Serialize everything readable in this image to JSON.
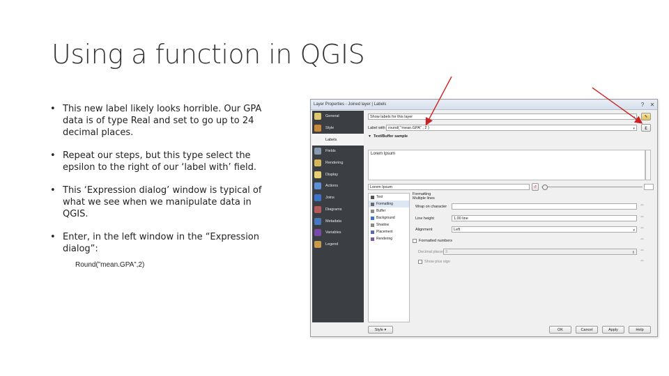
{
  "slide": {
    "title": "Using a function in QGIS",
    "bullets": [
      "This new label likely looks horrible. Our GPA data is of type Real and set to go up to 24 decimal places.",
      " Repeat our steps, but this type select the epsilon to the right of our ‘label with’ field.",
      "This ‘Expression dialog’ window is typical of what we see when we manipulate data in QGIS.",
      "Enter, in the left window in the “Expression dialog”:"
    ],
    "code_line": "Round(”mean.GPA”,2)"
  },
  "qgis": {
    "window_title": "Layer Properties - Joined layer | Labels",
    "title_controls": [
      "?",
      "✕"
    ],
    "sidebar": [
      {
        "label": "General",
        "color": "#e0c870"
      },
      {
        "label": "Style",
        "color": "#c98b3a"
      },
      {
        "label": "Labels",
        "color": "#f2f2f2"
      },
      {
        "label": "Fields",
        "color": "#8a9ab0"
      },
      {
        "label": "Rendering",
        "color": "#d6b85a"
      },
      {
        "label": "Display",
        "color": "#e8d070"
      },
      {
        "label": "Actions",
        "color": "#5d8fd6"
      },
      {
        "label": "Joins",
        "color": "#3b74c8"
      },
      {
        "label": "Diagrams",
        "color": "#b55a5a"
      },
      {
        "label": "Metadata",
        "color": "#4a78c0"
      },
      {
        "label": "Variables",
        "color": "#7c4aa8"
      },
      {
        "label": "Legend",
        "color": "#c89a4a"
      }
    ],
    "labels_mode": "Show labels for this layer",
    "label_with_label": "Label with",
    "label_with_value": "round( \"mean.GPA\" , 2 )",
    "epsilon_symbol": "ε",
    "sample_header": "Text/Buffer sample",
    "sample_text": "Lorem Ipsum",
    "sample_combo": "Lorem Ipsum",
    "subtabs": [
      "Text",
      "Formatting",
      "Buffer",
      "Background",
      "Shadow",
      "Placement",
      "Rendering"
    ],
    "formatting": {
      "header": "Formatting",
      "multiple_lines": "Multiple lines",
      "wrap_label": "Wrap on character",
      "wrap_value": "",
      "line_height_label": "Line height",
      "line_height_value": "1.00 line",
      "alignment_label": "Alignment",
      "alignment_value": "Left",
      "formatted_numbers": "Formatted numbers",
      "decimal_places_label": "Decimal places",
      "decimal_places_value": "3",
      "show_plus_sign": "Show plus sign"
    },
    "footer": {
      "style_btn": "Style",
      "ok": "OK",
      "cancel": "Cancel",
      "apply": "Apply",
      "help": "Help"
    },
    "colors": {
      "arrow": "#cc2222",
      "sidebar_bg": "#3b3f44"
    }
  }
}
